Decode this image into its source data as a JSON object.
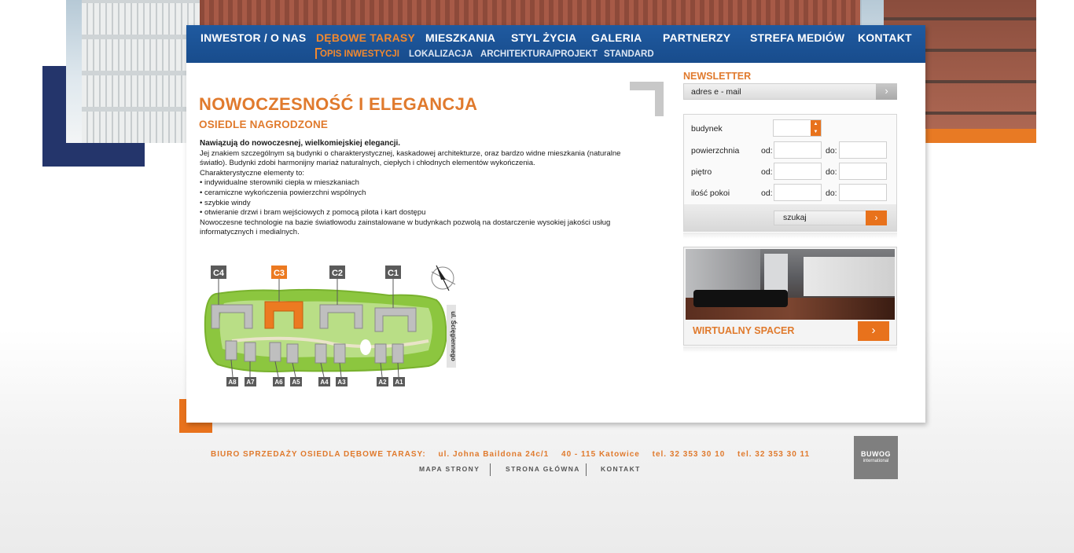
{
  "nav": {
    "main": [
      "INWESTOR / O NAS",
      "DĘBOWE TARASY",
      "MIESZKANIA",
      "STYL ŻYCIA",
      "GALERIA",
      "PARTNERZY",
      "STREFA MEDIÓW",
      "KONTAKT"
    ],
    "sub": [
      "OPIS INWESTYCJI",
      "LOKALIZACJA",
      "ARCHITEKTURA/PROJEKT",
      "STANDARD"
    ],
    "active_main": "DĘBOWE TARASY",
    "active_sub": "OPIS INWESTYCJI"
  },
  "content": {
    "title": "NOWOCZESNOŚĆ I ELEGANCJA",
    "subtitle": "OSIEDLE NAGRODZONE",
    "lead": "Nawiązują do nowoczesnej, wielkomiejskiej elegancji.",
    "paragraph1": "Jej znakiem szczególnym są budynki o charakterystycznej, kaskadowej architekturze, oraz bardzo widne mieszkania (naturalne światło). Budynki zdobi harmonijny mariaż naturalnych, ciepłych i chłodnych elementów wykończenia.",
    "features_intro": "Charakterystyczne elementy to:",
    "features": [
      "• indywidualne sterowniki ciepła w mieszkaniach",
      "• ceramiczne wykończenia powierzchni wspólnych",
      "• szybkie windy",
      "• otwieranie drzwi i bram wejściowych z pomocą pilota i kart dostępu"
    ],
    "paragraph2": "Nowoczesne technologie na bazie światłowodu zainstalowane w budynkach pozwolą na dostarczenie wysokiej jakości usług informatycznych i medialnych."
  },
  "site_plan": {
    "top_buildings": [
      "C4",
      "C3",
      "C2",
      "C1"
    ],
    "highlighted": "C3",
    "bottom_buildings": [
      "A8",
      "A7",
      "A6",
      "A5",
      "A4",
      "A3",
      "A2",
      "A1"
    ],
    "street": "ul. Ścięgiennego"
  },
  "newsletter": {
    "title": "NEWSLETTER",
    "placeholder": "adres e - mail",
    "button_glyph": "›"
  },
  "search": {
    "labels": {
      "building": "budynek",
      "area": "powierzchnia",
      "floor": "piętro",
      "rooms": "ilość pokoi"
    },
    "from": "od:",
    "to": "do:",
    "button": "szukaj",
    "arrow_glyph": "›"
  },
  "tour": {
    "label": "WIRTUALNY SPACER",
    "arrow_glyph": "›"
  },
  "footer": {
    "office": "BIURO SPRZEDAŻY OSIEDLA DĘBOWE TARASY:",
    "address": "ul. Johna Baildona 24c/1",
    "city": "40 - 115 Katowice",
    "phone1": "tel. 32 353 30 10",
    "phone2": "tel. 32 353 30 11",
    "links": [
      "MAPA STRONY",
      "STRONA GŁÓWNA",
      "KONTAKT"
    ],
    "brand": "BUWOG",
    "brand_sub": "international"
  },
  "colors": {
    "nav_blue": "#1f5aa0",
    "accent_orange": "#e07a2d",
    "deco_navy": "#24356b",
    "plan_green": "#8cc63f"
  }
}
